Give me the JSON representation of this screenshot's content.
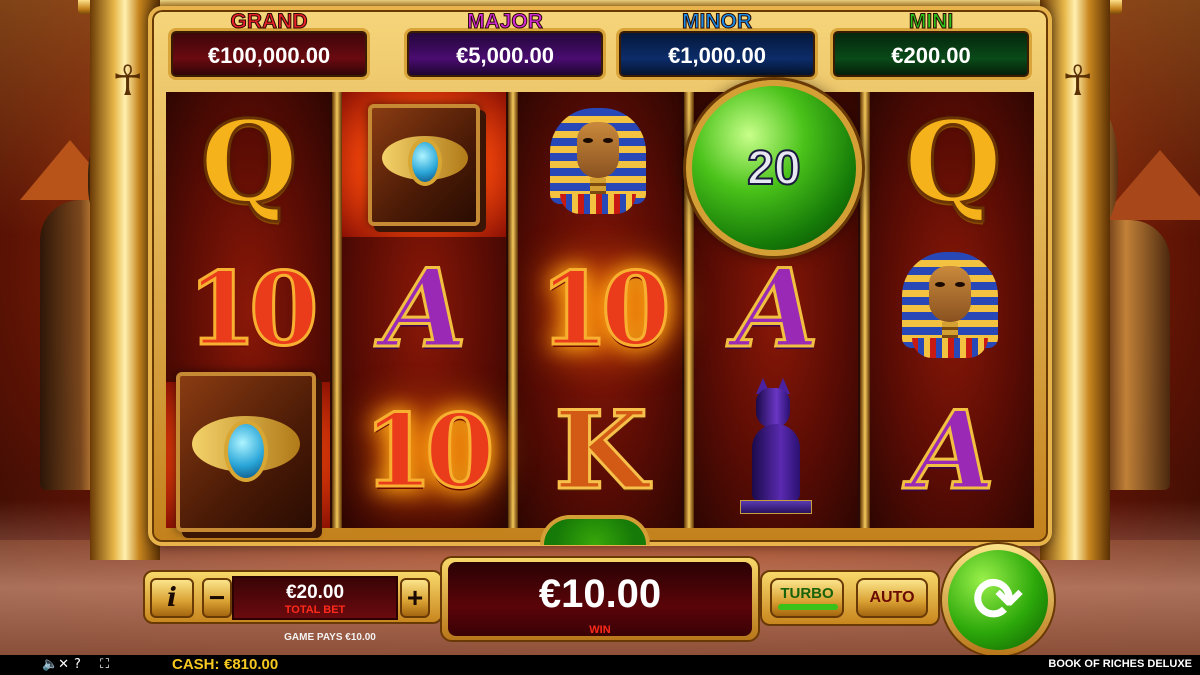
{
  "jackpots": [
    {
      "name": "GRAND",
      "value": "€100,000.00",
      "color": "#e8202a"
    },
    {
      "name": "MAJOR",
      "value": "€5,000.00",
      "color": "#d22ad8"
    },
    {
      "name": "MINOR",
      "value": "€1,000.00",
      "color": "#1a8ae8"
    },
    {
      "name": "MINI",
      "value": "€200.00",
      "color": "#2ac21a"
    }
  ],
  "reels": {
    "col1": {
      "top": "Q",
      "middle": "10",
      "bottom": "book-symbol"
    },
    "col2": {
      "top": "book-symbol",
      "middle": "A",
      "bottom": "10"
    },
    "col3": {
      "top": "pharaoh-symbol",
      "middle": "10",
      "bottom": "K"
    },
    "col4": {
      "top": "green-orb",
      "middle": "A",
      "bottom": "cat-symbol"
    },
    "col5": {
      "top": "Q",
      "middle": "pharaoh-symbol",
      "bottom": "A"
    }
  },
  "orb": {
    "value": "20"
  },
  "controls": {
    "info_label": "i",
    "minus_label": "−",
    "plus_label": "+",
    "bet_value": "€20.00",
    "bet_label": "TOTAL BET",
    "win_value": "€10.00",
    "win_label": "WIN",
    "turbo_label": "TURBO",
    "auto_label": "AUTO",
    "spin_icon": "spin-arrows-icon",
    "game_pays": "GAME PAYS €10.00"
  },
  "status_bar": {
    "cash_label": "CASH:",
    "cash_value": "€810.00",
    "game_title": "BOOK OF RICHES DELUXE"
  },
  "colors": {
    "accent_gold": "#e7b34a",
    "win_red": "#ff2a1a",
    "cash_yellow": "#f6c820",
    "spin_green": "#2ca80a"
  }
}
